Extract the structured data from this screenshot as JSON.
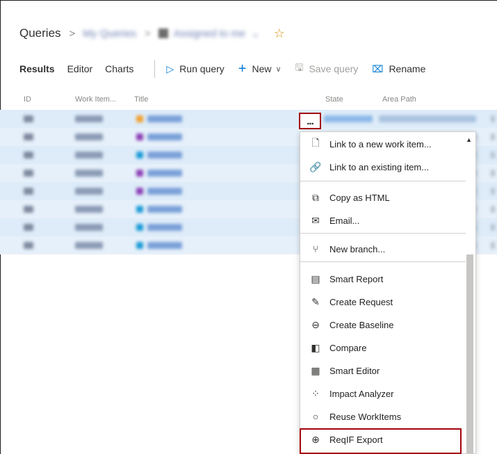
{
  "breadcrumb": {
    "root": "Queries",
    "folder": "My Queries",
    "query": "Assigned to me"
  },
  "toolbar": {
    "tabs": [
      "Results",
      "Editor",
      "Charts"
    ],
    "run_query": "Run query",
    "new": "New",
    "save_query": "Save query",
    "rename": "Rename"
  },
  "columns": {
    "id": "ID",
    "work_item_type": "Work Item...",
    "title": "Title",
    "state": "State",
    "area_path": "Area Path"
  },
  "rows_icon_colors": [
    "#f0a030",
    "#8b3fb5",
    "#1b9ad6",
    "#8b3fb5",
    "#8b3fb5",
    "#1b9ad6",
    "#1b9ad6",
    "#1b9ad6"
  ],
  "more_actions": "...",
  "menu": {
    "items": [
      {
        "label": "Link to a new work item...",
        "icon": "link-new-icon",
        "glyph": "🗋"
      },
      {
        "label": "Link to an existing item...",
        "icon": "link-icon",
        "glyph": "🔗"
      },
      {
        "label": "Copy as HTML",
        "icon": "copy-icon",
        "glyph": "⧉"
      },
      {
        "label": "Email...",
        "icon": "mail-icon",
        "glyph": "✉"
      },
      {
        "label": "New branch...",
        "icon": "branch-icon",
        "glyph": "⑂"
      },
      {
        "label": "Smart Report",
        "icon": "smart-report-icon",
        "glyph": "▤"
      },
      {
        "label": "Create Request",
        "icon": "edit-request-icon",
        "glyph": "✎"
      },
      {
        "label": "Create Baseline",
        "icon": "baseline-icon",
        "glyph": "⊖"
      },
      {
        "label": "Compare",
        "icon": "compare-icon",
        "glyph": "◧"
      },
      {
        "label": "Smart Editor",
        "icon": "smart-editor-icon",
        "glyph": "▦"
      },
      {
        "label": "Impact Analyzer",
        "icon": "impact-analyzer-icon",
        "glyph": "⁘"
      },
      {
        "label": "Reuse WorkItems",
        "icon": "reuse-icon",
        "glyph": "○"
      },
      {
        "label": "ReqIF Export",
        "icon": "reqif-export-icon",
        "glyph": "⊕"
      }
    ]
  },
  "colors": {
    "accent": "#0078d4",
    "highlight_border": "#a4000c",
    "selected_row": "#deecf9"
  }
}
